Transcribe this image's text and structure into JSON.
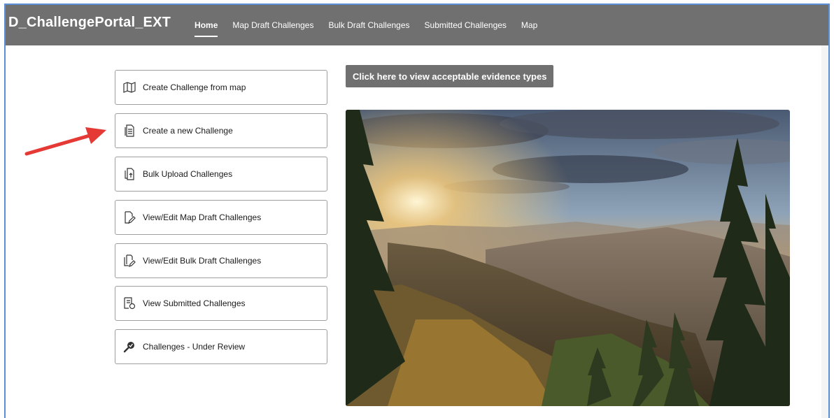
{
  "app": {
    "title": "D_ChallengePortal_EXT"
  },
  "nav": {
    "items": [
      {
        "label": "Home",
        "active": true
      },
      {
        "label": "Map Draft Challenges"
      },
      {
        "label": "Bulk Draft Challenges"
      },
      {
        "label": "Submitted Challenges"
      },
      {
        "label": "Map"
      }
    ]
  },
  "menu": {
    "items": [
      {
        "label": "Create Challenge from map",
        "icon": "map-icon"
      },
      {
        "label": "Create a new Challenge",
        "icon": "document-icon"
      },
      {
        "label": "Bulk Upload Challenges",
        "icon": "bulk-upload-icon"
      },
      {
        "label": "View/Edit Map Draft Challenges",
        "icon": "edit-document-icon"
      },
      {
        "label": "View/Edit Bulk Draft Challenges",
        "icon": "edit-documents-icon"
      },
      {
        "label": "View Submitted Challenges",
        "icon": "submitted-document-icon"
      },
      {
        "label": "Challenges - Under Review",
        "icon": "review-magnifier-icon"
      }
    ]
  },
  "evidence_button": {
    "label": "Click here to view acceptable evidence types"
  },
  "colors": {
    "navbar": "#707070",
    "annotation_arrow": "#e53935",
    "frame_border": "#5b8fd6"
  }
}
